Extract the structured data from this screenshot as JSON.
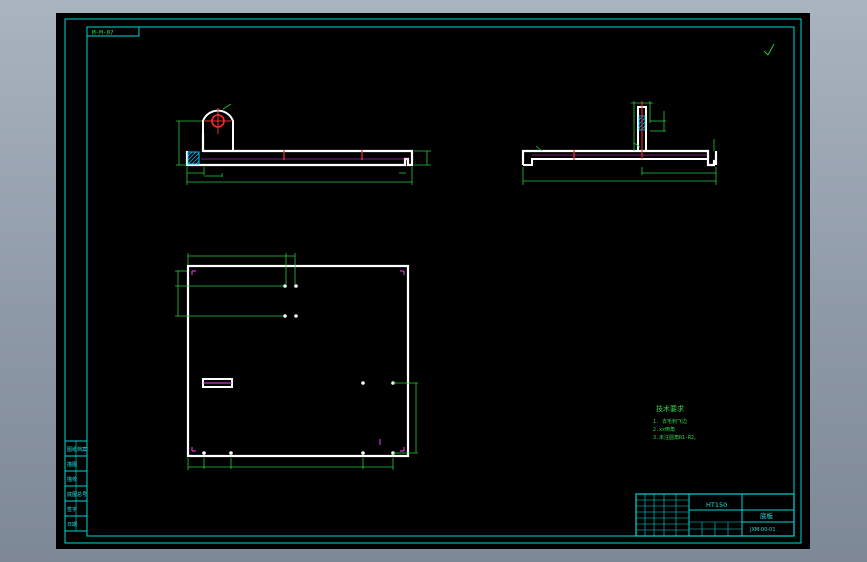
{
  "drawing": {
    "corner_label": "M-M-07",
    "material": "HT150",
    "part_name": "底板",
    "drawing_no": "JXM-00-01",
    "tech_title": "技术要求",
    "tech_notes": [
      "1. 去毛刺飞边",
      "2.xx倒角",
      "3.未注圆角R1-R2。"
    ],
    "side_tags": [
      "图纸档案",
      "描图",
      "描校",
      "底图总号",
      "签字",
      "日期"
    ]
  },
  "colors": {
    "background": "#000000",
    "frame": "#00d6d6",
    "outline": "#ffffff",
    "dimension": "#29c83a",
    "centerline": "#ff2a2a",
    "hidden": "#ff3cff"
  }
}
